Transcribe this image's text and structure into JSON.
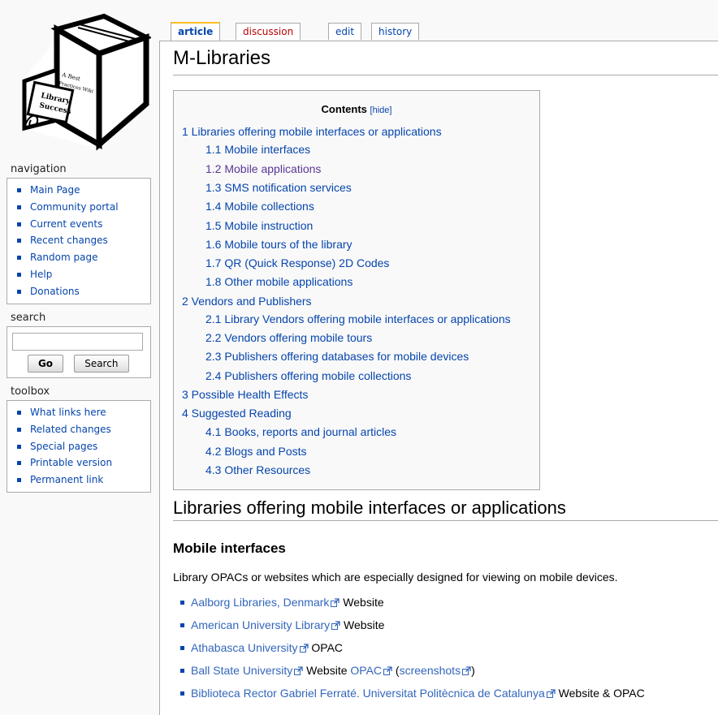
{
  "logo": {
    "line1": "A Best",
    "line2": "Practices Wiki",
    "line3": "Library",
    "line4": "Success"
  },
  "tabs": {
    "article": "article",
    "discussion": "discussion",
    "edit": "edit",
    "history": "history"
  },
  "navigation": {
    "heading": "navigation",
    "items": [
      "Main Page",
      "Community portal",
      "Current events",
      "Recent changes",
      "Random page",
      "Help",
      "Donations"
    ]
  },
  "search": {
    "heading": "search",
    "go": "Go",
    "search": "Search",
    "value": ""
  },
  "toolbox": {
    "heading": "toolbox",
    "items": [
      "What links here",
      "Related changes",
      "Special pages",
      "Printable version",
      "Permanent link"
    ]
  },
  "page": {
    "title": "M-Libraries"
  },
  "toc": {
    "title": "Contents",
    "hide": "[hide]",
    "items": [
      "1 Libraries offering mobile interfaces or applications",
      "1.1 Mobile interfaces",
      "1.2 Mobile applications",
      "1.3 SMS notification services",
      "1.4 Mobile collections",
      "1.5 Mobile instruction",
      "1.6 Mobile tours of the library",
      "1.7 QR (Quick Response) 2D Codes",
      "1.8 Other mobile applications",
      "2 Vendors and Publishers",
      "2.1 Library Vendors offering mobile interfaces or applications",
      "2.2 Vendors offering mobile tours",
      "2.3 Publishers offering databases for mobile devices",
      "2.4 Publishers offering mobile collections",
      "3 Possible Health Effects",
      "4 Suggested Reading",
      "4.1 Books, reports and journal articles",
      "4.2 Blogs and Posts",
      "4.3 Other Resources"
    ]
  },
  "section": {
    "heading": "Libraries offering mobile interfaces or applications",
    "subheading": "Mobile interfaces",
    "intro": "Library OPACs or websites which are especially designed for viewing on mobile devices.",
    "list": [
      {
        "link": "Aalborg Libraries, Denmark",
        "text": " Website"
      },
      {
        "link": "American University Library",
        "text": " Website"
      },
      {
        "link": "Athabasca University",
        "text": " OPAC"
      },
      {
        "link": "Ball State University",
        "text": " Website ",
        "link2": "OPAC",
        "text2": " (",
        "link3": "screenshots",
        "text3": ")"
      },
      {
        "link": "Biblioteca Rector Gabriel Ferraté. Universitat Politècnica de Catalunya",
        "text": " Website & OPAC"
      }
    ]
  }
}
